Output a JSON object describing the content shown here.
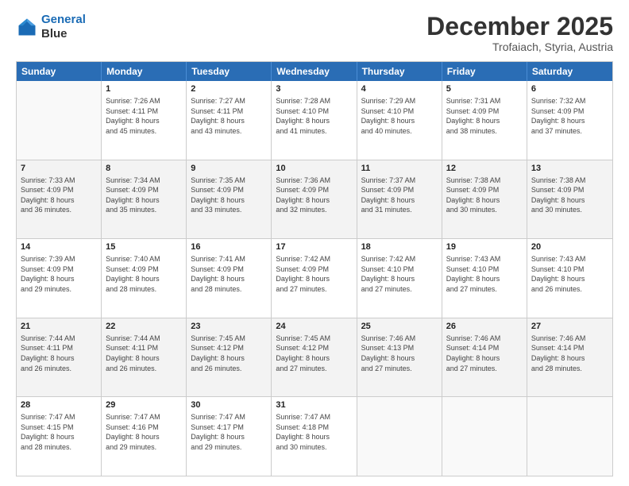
{
  "logo": {
    "line1": "General",
    "line2": "Blue"
  },
  "title": "December 2025",
  "subtitle": "Trofaiach, Styria, Austria",
  "header_days": [
    "Sunday",
    "Monday",
    "Tuesday",
    "Wednesday",
    "Thursday",
    "Friday",
    "Saturday"
  ],
  "weeks": [
    [
      {
        "day": "",
        "info": ""
      },
      {
        "day": "1",
        "info": "Sunrise: 7:26 AM\nSunset: 4:11 PM\nDaylight: 8 hours\nand 45 minutes."
      },
      {
        "day": "2",
        "info": "Sunrise: 7:27 AM\nSunset: 4:11 PM\nDaylight: 8 hours\nand 43 minutes."
      },
      {
        "day": "3",
        "info": "Sunrise: 7:28 AM\nSunset: 4:10 PM\nDaylight: 8 hours\nand 41 minutes."
      },
      {
        "day": "4",
        "info": "Sunrise: 7:29 AM\nSunset: 4:10 PM\nDaylight: 8 hours\nand 40 minutes."
      },
      {
        "day": "5",
        "info": "Sunrise: 7:31 AM\nSunset: 4:09 PM\nDaylight: 8 hours\nand 38 minutes."
      },
      {
        "day": "6",
        "info": "Sunrise: 7:32 AM\nSunset: 4:09 PM\nDaylight: 8 hours\nand 37 minutes."
      }
    ],
    [
      {
        "day": "7",
        "info": "Sunrise: 7:33 AM\nSunset: 4:09 PM\nDaylight: 8 hours\nand 36 minutes."
      },
      {
        "day": "8",
        "info": "Sunrise: 7:34 AM\nSunset: 4:09 PM\nDaylight: 8 hours\nand 35 minutes."
      },
      {
        "day": "9",
        "info": "Sunrise: 7:35 AM\nSunset: 4:09 PM\nDaylight: 8 hours\nand 33 minutes."
      },
      {
        "day": "10",
        "info": "Sunrise: 7:36 AM\nSunset: 4:09 PM\nDaylight: 8 hours\nand 32 minutes."
      },
      {
        "day": "11",
        "info": "Sunrise: 7:37 AM\nSunset: 4:09 PM\nDaylight: 8 hours\nand 31 minutes."
      },
      {
        "day": "12",
        "info": "Sunrise: 7:38 AM\nSunset: 4:09 PM\nDaylight: 8 hours\nand 30 minutes."
      },
      {
        "day": "13",
        "info": "Sunrise: 7:38 AM\nSunset: 4:09 PM\nDaylight: 8 hours\nand 30 minutes."
      }
    ],
    [
      {
        "day": "14",
        "info": "Sunrise: 7:39 AM\nSunset: 4:09 PM\nDaylight: 8 hours\nand 29 minutes."
      },
      {
        "day": "15",
        "info": "Sunrise: 7:40 AM\nSunset: 4:09 PM\nDaylight: 8 hours\nand 28 minutes."
      },
      {
        "day": "16",
        "info": "Sunrise: 7:41 AM\nSunset: 4:09 PM\nDaylight: 8 hours\nand 28 minutes."
      },
      {
        "day": "17",
        "info": "Sunrise: 7:42 AM\nSunset: 4:09 PM\nDaylight: 8 hours\nand 27 minutes."
      },
      {
        "day": "18",
        "info": "Sunrise: 7:42 AM\nSunset: 4:10 PM\nDaylight: 8 hours\nand 27 minutes."
      },
      {
        "day": "19",
        "info": "Sunrise: 7:43 AM\nSunset: 4:10 PM\nDaylight: 8 hours\nand 27 minutes."
      },
      {
        "day": "20",
        "info": "Sunrise: 7:43 AM\nSunset: 4:10 PM\nDaylight: 8 hours\nand 26 minutes."
      }
    ],
    [
      {
        "day": "21",
        "info": "Sunrise: 7:44 AM\nSunset: 4:11 PM\nDaylight: 8 hours\nand 26 minutes."
      },
      {
        "day": "22",
        "info": "Sunrise: 7:44 AM\nSunset: 4:11 PM\nDaylight: 8 hours\nand 26 minutes."
      },
      {
        "day": "23",
        "info": "Sunrise: 7:45 AM\nSunset: 4:12 PM\nDaylight: 8 hours\nand 26 minutes."
      },
      {
        "day": "24",
        "info": "Sunrise: 7:45 AM\nSunset: 4:12 PM\nDaylight: 8 hours\nand 27 minutes."
      },
      {
        "day": "25",
        "info": "Sunrise: 7:46 AM\nSunset: 4:13 PM\nDaylight: 8 hours\nand 27 minutes."
      },
      {
        "day": "26",
        "info": "Sunrise: 7:46 AM\nSunset: 4:14 PM\nDaylight: 8 hours\nand 27 minutes."
      },
      {
        "day": "27",
        "info": "Sunrise: 7:46 AM\nSunset: 4:14 PM\nDaylight: 8 hours\nand 28 minutes."
      }
    ],
    [
      {
        "day": "28",
        "info": "Sunrise: 7:47 AM\nSunset: 4:15 PM\nDaylight: 8 hours\nand 28 minutes."
      },
      {
        "day": "29",
        "info": "Sunrise: 7:47 AM\nSunset: 4:16 PM\nDaylight: 8 hours\nand 29 minutes."
      },
      {
        "day": "30",
        "info": "Sunrise: 7:47 AM\nSunset: 4:17 PM\nDaylight: 8 hours\nand 29 minutes."
      },
      {
        "day": "31",
        "info": "Sunrise: 7:47 AM\nSunset: 4:18 PM\nDaylight: 8 hours\nand 30 minutes."
      },
      {
        "day": "",
        "info": ""
      },
      {
        "day": "",
        "info": ""
      },
      {
        "day": "",
        "info": ""
      }
    ]
  ]
}
